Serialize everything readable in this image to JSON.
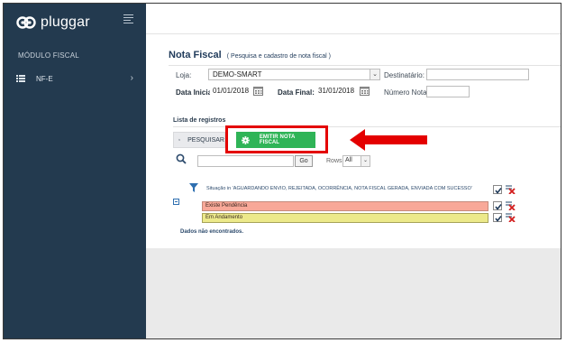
{
  "brand": {
    "name": "pluggar"
  },
  "sidebar": {
    "section_title": "MÓDULO FISCAL",
    "items": [
      {
        "label": "NF-E",
        "icon": "list-icon"
      }
    ]
  },
  "page": {
    "title": "Nota Fiscal",
    "subtitle": "( Pesquisa e cadastro de nota fiscal )"
  },
  "form": {
    "loja_label": "Loja:",
    "loja_value": "DEMO-SMART",
    "destinatario_label": "Destinatário:",
    "destinatario_value": "",
    "data_inicial_label": "Data Inicial:",
    "data_inicial_value": "01/01/2018",
    "data_final_label": "Data Final:",
    "data_final_value": "31/01/2018",
    "numero_nota_label": "Número Nota:",
    "numero_nota_value": ""
  },
  "registros": {
    "section_title": "Lista de registros",
    "pesquisar_label": "PESQUISAR",
    "emitir_label": "EMITIR NOTA FISCAL",
    "go_label": "Go",
    "rows_label": "Rows",
    "rows_value": "All",
    "filter_condition": "Situação in 'AGUARDANDO ENVIO, REJEITADA, OCORRÊNCIA, NOTA FISCAL GERADA, ENVIADA COM SUCESSO'",
    "highlights": [
      {
        "label": "Existe Pendência",
        "color": "#f8a898"
      },
      {
        "label": "Em Andamento",
        "color": "#ece98a"
      }
    ],
    "empty_message": "Dados não encontrados."
  },
  "colors": {
    "sidebar_bg": "#233a4f",
    "title": "#1f3a5a",
    "emitir_green": "#2fb457",
    "annotation_red": "#e40000"
  }
}
